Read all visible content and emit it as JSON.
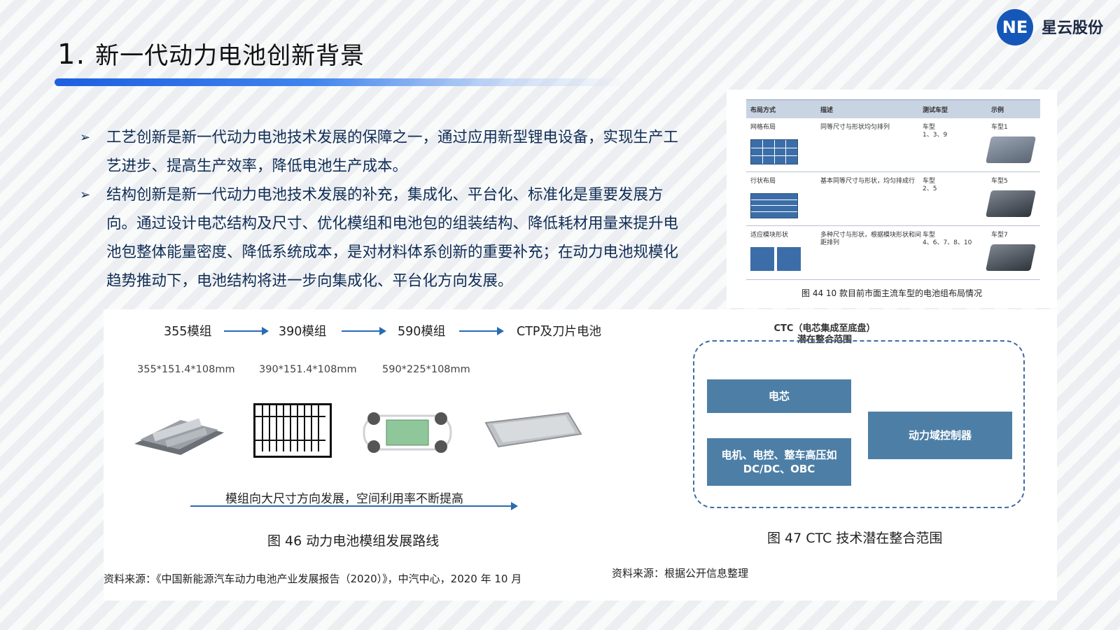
{
  "header": {
    "number": "1.",
    "title": "新一代动力电池创新背景",
    "logo_text": "NE",
    "brand": "星云股份"
  },
  "bullets": [
    "工艺创新是新一代动力电池技术发展的保障之一，通过应用新型锂电设备，实现生产工艺进步、提高生产效率，降低电池生产成本。",
    "结构创新是新一代动力电池技术发展的补充，集成化、平台化、标准化是重要发展方向。通过设计电芯结构及尺寸、优化模组和电池包的组装结构、降低耗材用量来提升电池包整体能量密度、降低系统成本，是对材料体系创新的重要补充；在动力电池规模化趋势推动下，电池结构将进一步向集成化、平台化方向发展。"
  ],
  "table": {
    "headers": [
      "布局方式",
      "描述",
      "测试车型",
      "示例"
    ],
    "rows": [
      {
        "layout": "网格布局",
        "desc": "同等尺寸与形状均匀排列",
        "model": "车型\n1、3、9",
        "example": "车型1"
      },
      {
        "layout": "行状布局",
        "desc": "基本同等尺寸与形状，均匀排成行",
        "model": "车型\n2、5",
        "example": "车型5"
      },
      {
        "layout": "适应模块形状",
        "desc": "多种尺寸与形状，根据模块形状和间距排列",
        "model": "车型\n4、6、7、8、10",
        "example": "车型7"
      }
    ],
    "caption": "图 44 10 款目前市面主流车型的电池组布局情况"
  },
  "roadmap": {
    "stages": [
      "355模组",
      "390模组",
      "590模组",
      "CTP及刀片电池"
    ],
    "dims": [
      "355*151.4*108mm",
      "390*151.4*108mm",
      "590*225*108mm"
    ],
    "trend": "模组向大尺寸方向发展，空间利用率不断提高",
    "caption": "图  46  动力电池模组发展路线",
    "source": "资料来源：《中国新能源汽车动力电池产业发展报告（2020）》，中汽中心，2020 年 10 月"
  },
  "ctc": {
    "title_line1": "CTC（电芯集成至底盘）",
    "title_line2": "潜在整合范围",
    "box1": "电芯",
    "box2_line1": "电机、电控、整车高压如",
    "box2_line2": "DC/DC、OBC",
    "box3": "动力域控制器",
    "caption": "图 47 CTC 技术潜在整合范围",
    "source": "资料来源：根据公开信息整理"
  }
}
